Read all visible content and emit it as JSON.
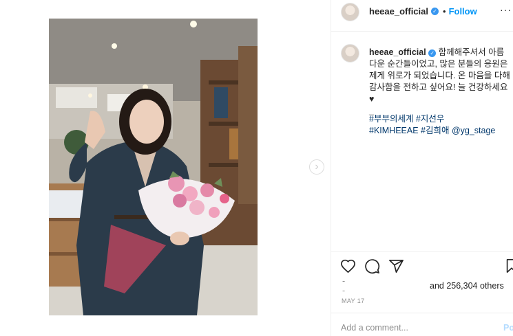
{
  "header": {
    "username": "heeae_official",
    "separator": "•",
    "follow_label": "Follow",
    "more": "···"
  },
  "caption": {
    "username": "heeae_official",
    "text": "함께해주셔서 아름다운 순간들이었고, 많은 분들의 응원은 제게 위로가 되었습니다. 온 마음을 다해 감사함을 전하고 싶어요! 늘 건강하세요",
    "dash": "_",
    "hashtag_line1": "#부부의세계 #지선우",
    "hashtag_line2": "#KIMHEEAE #김희애 @yg_stage"
  },
  "carousel": {
    "next_glyph": "›"
  },
  "actions": {
    "like_icon": "heart-icon",
    "comment_icon": "comment-icon",
    "share_icon": "share-icon",
    "save_icon": "bookmark-icon"
  },
  "likes": {
    "tick1": "-",
    "tick2": "-",
    "text": "and 256,304 others"
  },
  "date": "MAY 17",
  "comment": {
    "placeholder": "Add a comment...",
    "post_label": "Po"
  },
  "colors": {
    "accent": "#0095f6",
    "verified": "#3897f0",
    "hashtag": "#00376b",
    "muted": "#8e8e8e",
    "border": "#efefef"
  }
}
